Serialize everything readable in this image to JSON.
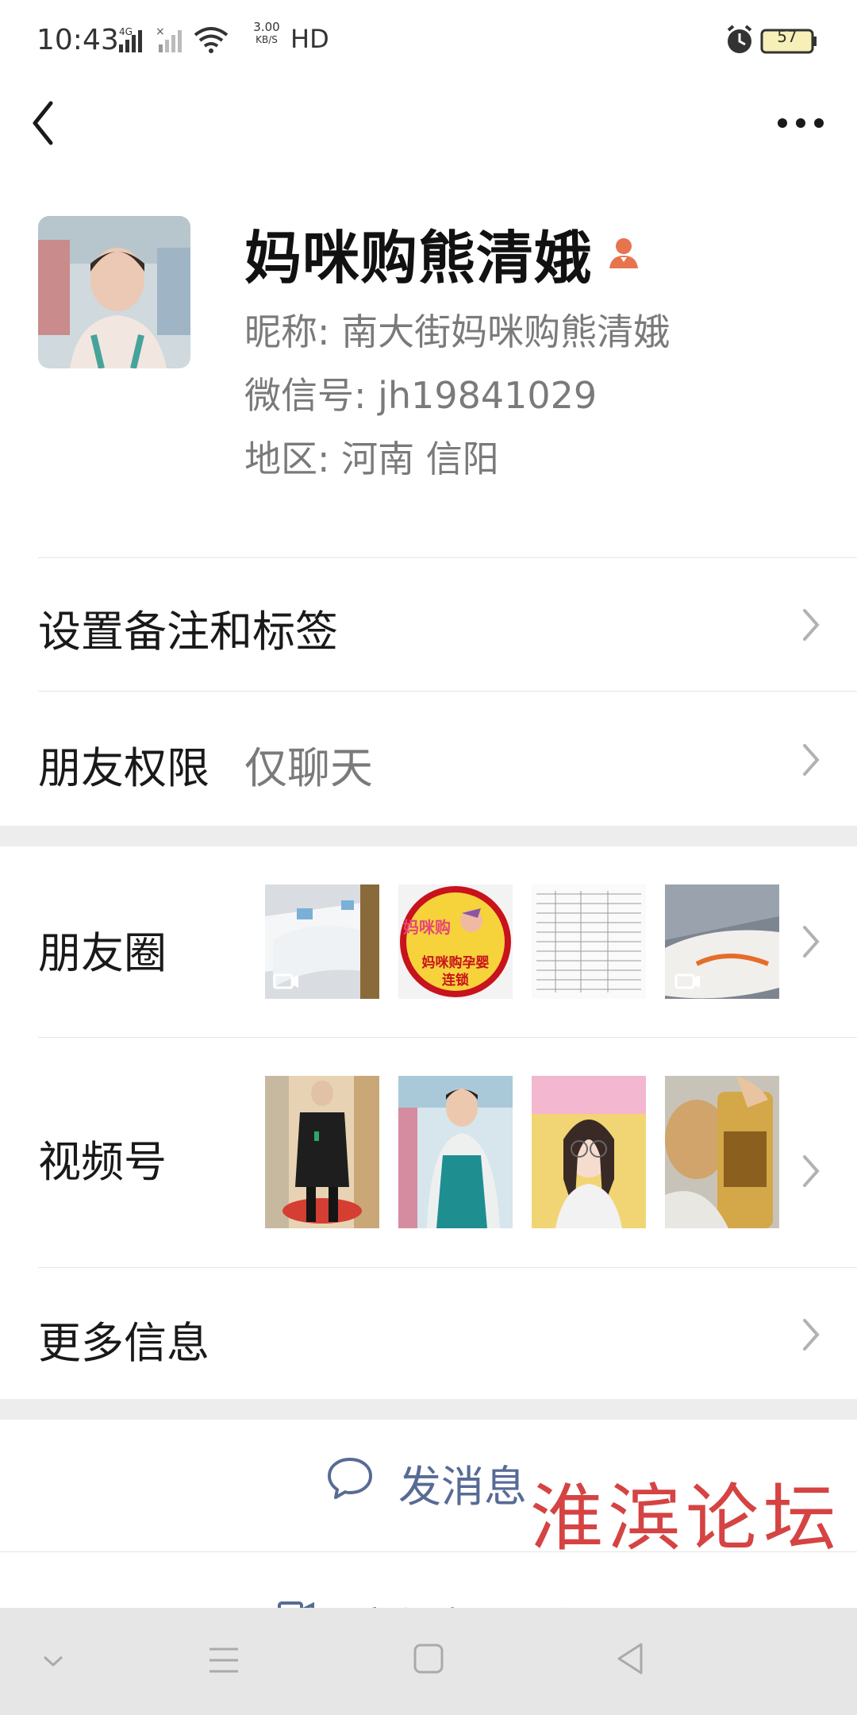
{
  "status_bar": {
    "time": "10:43",
    "network_speed_top": "3.00",
    "network_speed_unit": "KB/S",
    "hd_label": "HD",
    "battery": "57"
  },
  "profile": {
    "name": "妈咪购熊清娥",
    "nickname_label": "昵称: ",
    "nickname": "南大街妈咪购熊清娥",
    "wechat_id_label": "微信号: ",
    "wechat_id": "jh19841029",
    "region_label": "地区: ",
    "region": "河南  信阳"
  },
  "cells": {
    "remark_tags": "设置备注和标签",
    "friend_permission": "朋友权限",
    "friend_permission_value": "仅聊天",
    "moments": "朋友圈",
    "channels": "视频号",
    "more_info": "更多信息"
  },
  "moments_thumbs": [
    {
      "icon": "video-icon"
    },
    {
      "logo_top": "妈咪购",
      "logo_mid": "妈咪购孕婴",
      "logo_bottom": "连锁"
    },
    {},
    {
      "icon": "video-icon"
    }
  ],
  "actions": {
    "send_message": "发消息",
    "av_call": "音视频通话"
  },
  "watermark": "淮滨论坛",
  "colors": {
    "link_blue": "#576b95",
    "gender_icon": "#e8734f",
    "watermark_red": "#d23434"
  }
}
